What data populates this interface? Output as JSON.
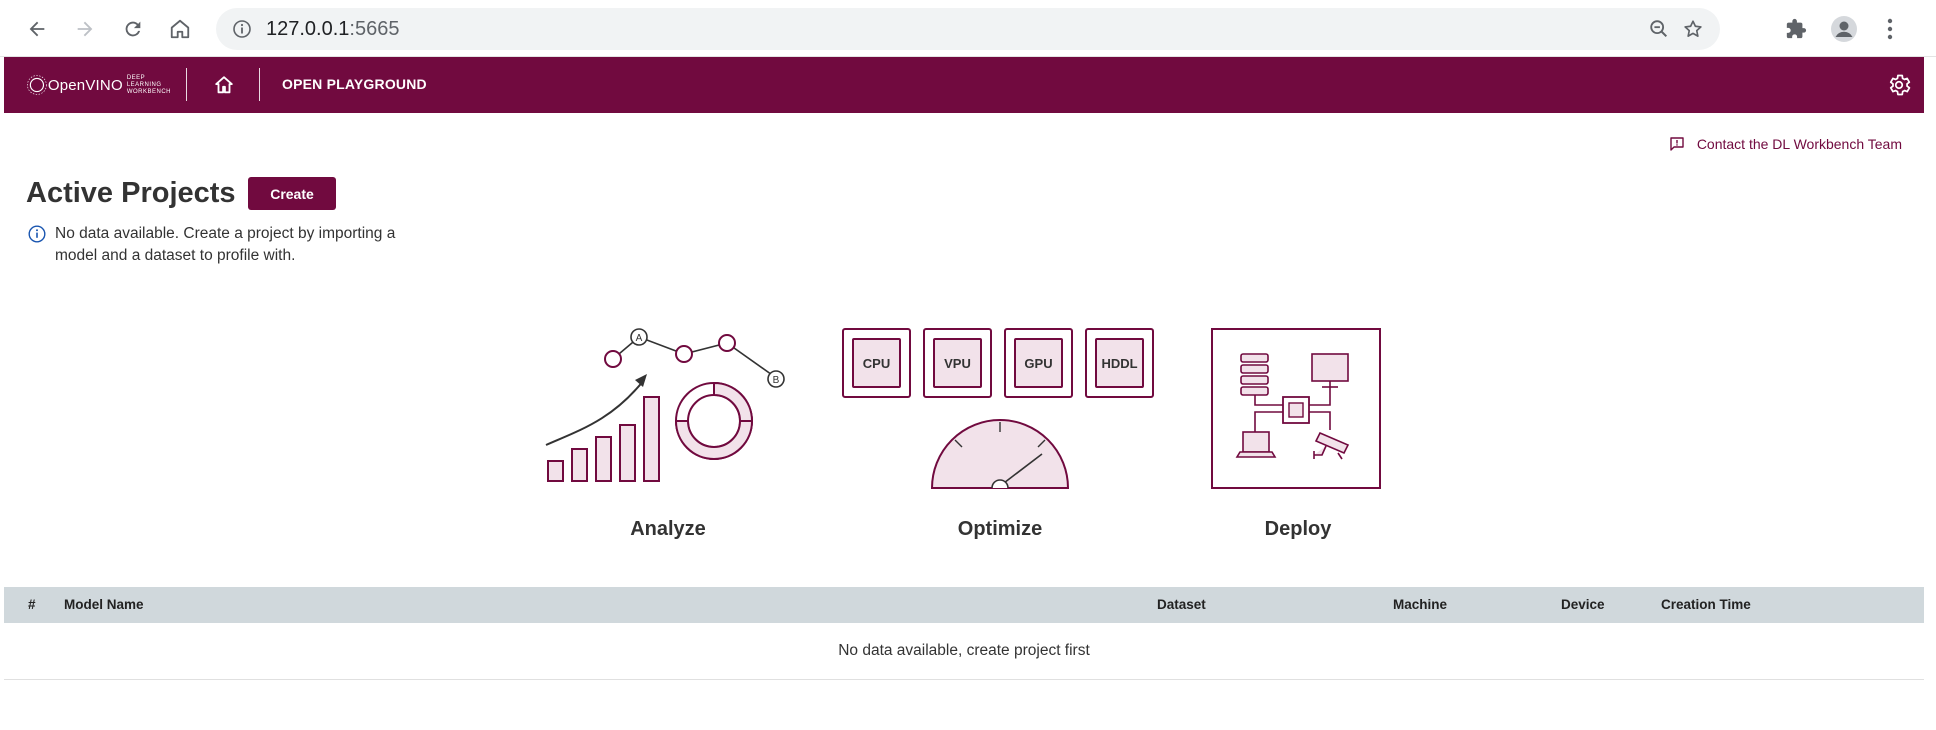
{
  "browser": {
    "url_host": "127.0.0.1",
    "url_port": ":5665"
  },
  "header": {
    "logo_text": "OpenVINO",
    "logo_sub_line1": "DEEP LEARNING",
    "logo_sub_line2": "WORKBENCH",
    "playground_label": "OPEN PLAYGROUND"
  },
  "main": {
    "contact_label": "Contact the DL Workbench Team",
    "title": "Active Projects",
    "create_label": "Create",
    "info_text": "No data available. Create a project by importing a model and a dataset to profile with."
  },
  "features": {
    "analyze": {
      "label": "Analyze",
      "point_a": "A",
      "point_b": "B"
    },
    "optimize": {
      "label": "Optimize",
      "chips": [
        "CPU",
        "VPU",
        "GPU",
        "HDDL"
      ]
    },
    "deploy": {
      "label": "Deploy"
    }
  },
  "table": {
    "columns": [
      "#",
      "Model Name",
      "Dataset",
      "Machine",
      "Device",
      "Creation Time"
    ],
    "empty_message": "No data available, create project first"
  },
  "colors": {
    "brand": "#710a3f",
    "table_header": "#d0d8dc",
    "illustration_fill": "#f2e2ea"
  }
}
